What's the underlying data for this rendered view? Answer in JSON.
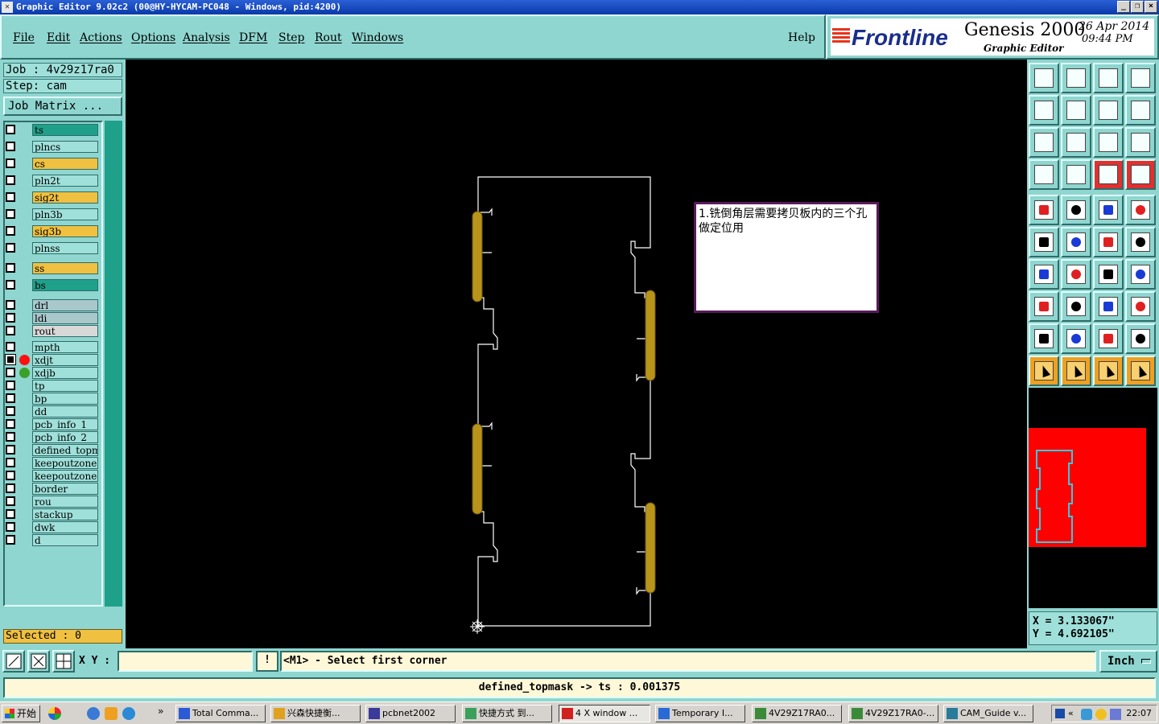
{
  "window": {
    "title": "Graphic Editor 9.02c2  (00@HY-HYCAM-PC048 - Windows, pid:4200)",
    "minimize": "_",
    "restore": "❐",
    "close": "×"
  },
  "menu": {
    "items": [
      "File",
      "Edit",
      "Actions",
      "Options",
      "Analysis",
      "DFM",
      "Step",
      "Rout",
      "Windows"
    ],
    "help": "Help"
  },
  "brand": {
    "logo": "Frontline",
    "product": "Genesis 2000",
    "subtitle": "Graphic Editor",
    "date": "26 Apr 2014",
    "time": "09:44 PM"
  },
  "job": {
    "job_label": "Job : 4v29z17ra0",
    "step_label": "Step: cam",
    "matrix_button": "Job Matrix ..."
  },
  "layers": [
    {
      "name": "ts",
      "color": "#1fa08a",
      "state": "off",
      "dot": ""
    },
    {
      "name": "plncs",
      "color": "#9fe0da",
      "state": "off",
      "dot": ""
    },
    {
      "name": "cs",
      "color": "#f0c040",
      "state": "off",
      "dot": ""
    },
    {
      "name": "pln2t",
      "color": "#9fe0da",
      "state": "off",
      "dot": ""
    },
    {
      "name": "sig2t",
      "color": "#f0c040",
      "state": "off",
      "dot": ""
    },
    {
      "name": "pln3b",
      "color": "#9fe0da",
      "state": "off",
      "dot": ""
    },
    {
      "name": "sig3b",
      "color": "#f0c040",
      "state": "off",
      "dot": ""
    },
    {
      "name": "plnss",
      "color": "#9fe0da",
      "state": "off",
      "dot": ""
    },
    {
      "name": "ss",
      "color": "#f0c040",
      "state": "off",
      "dot": ""
    },
    {
      "name": "bs",
      "color": "#1fa08a",
      "state": "off",
      "dot": ""
    },
    {
      "name": "drl",
      "color": "#a8c8cc",
      "state": "off",
      "dot": ""
    },
    {
      "name": "ldi",
      "color": "#a8c8cc",
      "state": "off",
      "dot": ""
    },
    {
      "name": "rout",
      "color": "#d8d8d8",
      "state": "off",
      "dot": ""
    },
    {
      "name": "mpth",
      "color": "#9fe0da",
      "state": "off",
      "dot": ""
    },
    {
      "name": "xdjt",
      "color": "#9fe0da",
      "state": "on",
      "dot": "#ff1010"
    },
    {
      "name": "xdjb",
      "color": "#9fe0da",
      "state": "off",
      "dot": "#3aa02a"
    },
    {
      "name": "tp",
      "color": "#9fe0da",
      "state": "off",
      "dot": ""
    },
    {
      "name": "bp",
      "color": "#9fe0da",
      "state": "off",
      "dot": ""
    },
    {
      "name": "dd",
      "color": "#9fe0da",
      "state": "off",
      "dot": ""
    },
    {
      "name": "pcb_info_1",
      "color": "#9fe0da",
      "state": "off",
      "dot": ""
    },
    {
      "name": "pcb_info_2",
      "color": "#9fe0da",
      "state": "off",
      "dot": ""
    },
    {
      "name": "defined_topmask",
      "color": "#9fe0da",
      "state": "off",
      "dot": ""
    },
    {
      "name": "keepoutzone",
      "color": "#9fe0da",
      "state": "off",
      "dot": ""
    },
    {
      "name": "keepoutzone",
      "color": "#9fe0da",
      "state": "off",
      "dot": ""
    },
    {
      "name": "border",
      "color": "#9fe0da",
      "state": "off",
      "dot": ""
    },
    {
      "name": "rou",
      "color": "#9fe0da",
      "state": "off",
      "dot": ""
    },
    {
      "name": "stackup",
      "color": "#9fe0da",
      "state": "off",
      "dot": ""
    },
    {
      "name": "dwk",
      "color": "#9fe0da",
      "state": "off",
      "dot": ""
    },
    {
      "name": "d",
      "color": "#9fe0da",
      "state": "off",
      "dot": ""
    }
  ],
  "selected": "Selected : 0",
  "note": "1.铣倒角层需要拷贝板内的三个孔做定位用",
  "coords": {
    "x": "X = 3.133067\"",
    "y": "Y = 4.692105\""
  },
  "command": {
    "xy_label": "X Y :",
    "xy_value": "",
    "warn": "!",
    "prompt": "<M1> - Select first corner",
    "units": "Inch"
  },
  "status": "defined_topmask -> ts : 0.001375",
  "toolbox": [
    "import-icon",
    "export-icon",
    "home-icon",
    "split-view-icon",
    "move-left-icon",
    "move-right-icon",
    "undo-icon",
    "swap-icon",
    "fit-icon",
    "zoom-fit-icon",
    "scale-1to2-icon",
    "help-icon",
    "snap-icon",
    "grid-icon",
    "layers-toggle-icon",
    "layers-toggle-alt-icon",
    "pad-icon",
    "line-draw-icon",
    "ruler-icon",
    "circle-fill-icon",
    "connect-icon",
    "cross-icon",
    "point-connect-icon",
    "point-connect-alt-icon",
    "angle-icon",
    "diagonal-icon",
    "arc-icon",
    "flip-icon",
    "square-dot-icon",
    "horizontal-line-icon",
    "measure-icon",
    "shapes-icon",
    "triangle-icon",
    "triangle-outline-icon",
    "triangle-a-icon",
    "triangle-line-icon",
    "pointer-icon",
    "pointer-select-icon",
    "pointer-alt-icon",
    "route-icon"
  ],
  "taskbar": {
    "start": "开始",
    "tasks": [
      {
        "label": "Total Comma...",
        "active": false
      },
      {
        "label": "兴森快捷衡...",
        "active": false
      },
      {
        "label": "pcbnet2002",
        "active": false
      },
      {
        "label": "快捷方式 到...",
        "active": false
      },
      {
        "label": "4 X window ...",
        "active": true
      },
      {
        "label": "Temporary I...",
        "active": false
      },
      {
        "label": "4V29Z17RA0...",
        "active": false
      },
      {
        "label": "4V29Z17RA0-...",
        "active": false
      },
      {
        "label": "CAM_Guide v...",
        "active": false
      }
    ],
    "chevron": "»",
    "clock": "22:07"
  },
  "colors": {
    "panel": "#8fd6d0",
    "canvas": "#000000",
    "outline": "#ffffff",
    "slot": "#b8941a",
    "overview_red": "#ff0000"
  }
}
